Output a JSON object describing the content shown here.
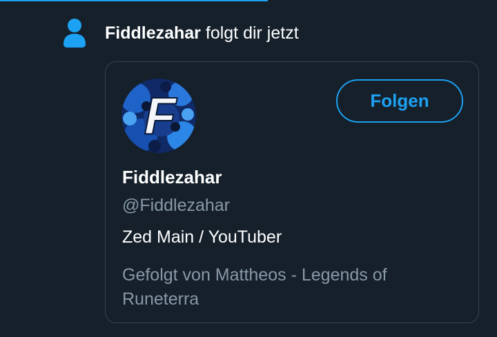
{
  "notification": {
    "icon": "person-icon",
    "user_name": "Fiddlezahar",
    "action_text": " folgt dir jetzt"
  },
  "card": {
    "avatar_letter": "F",
    "follow_label": "Folgen",
    "display_name": "Fiddlezahar",
    "handle": "@Fiddlezahar",
    "bio": "Zed Main / YouTuber",
    "followed_by": "Gefolgt von Mattheos - Legends of Runeterra"
  },
  "colors": {
    "background": "#15202b",
    "accent": "#1da1f2",
    "secondary_text": "#8899a6",
    "border": "#38444d"
  }
}
